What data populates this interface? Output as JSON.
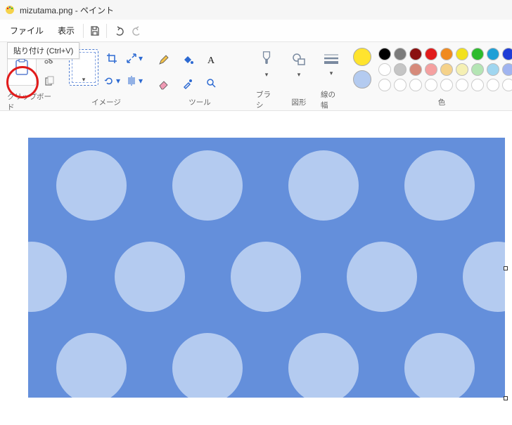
{
  "titlebar": {
    "filename": "mizutama.png",
    "separator": " - ",
    "app_name": "ペイント"
  },
  "tooltip": {
    "text": "貼り付け (Ctrl+V)"
  },
  "menu": {
    "file": "ファイル",
    "view": "表示"
  },
  "ribbon": {
    "clipboard": {
      "label": "クリップボード"
    },
    "image": {
      "label": "イメージ"
    },
    "tools": {
      "label": "ツール"
    },
    "brushes": {
      "label": "ブラシ"
    },
    "shapes": {
      "label": "図形"
    },
    "size": {
      "label": "線の幅"
    },
    "colors": {
      "label": "色"
    }
  },
  "colors": {
    "primary": "#ffe42e",
    "secondary": "#b4cbf0",
    "row1": [
      "#000000",
      "#7b7b7b",
      "#8a0f0f",
      "#e11b1b",
      "#f08a1e",
      "#f2e11e",
      "#2dbb2d",
      "#1e9fd6",
      "#1e3dd6",
      "#8a1ed6"
    ],
    "row2": [
      "#ffffff",
      "#c5c5c5",
      "#d68a7a",
      "#f5a0a0",
      "#f5d28a",
      "#f5f0b4",
      "#b4e5b4",
      "#a0d6f0",
      "#a0b4f0",
      "#d6a0f0"
    ],
    "row3": [
      "#ffffff",
      "#ffffff",
      "#ffffff",
      "#ffffff",
      "#ffffff",
      "#ffffff",
      "#ffffff",
      "#ffffff",
      "#ffffff",
      "#ffffff"
    ]
  },
  "canvas": {
    "bg": "#648fdb",
    "dot": "#b4cbf0"
  }
}
